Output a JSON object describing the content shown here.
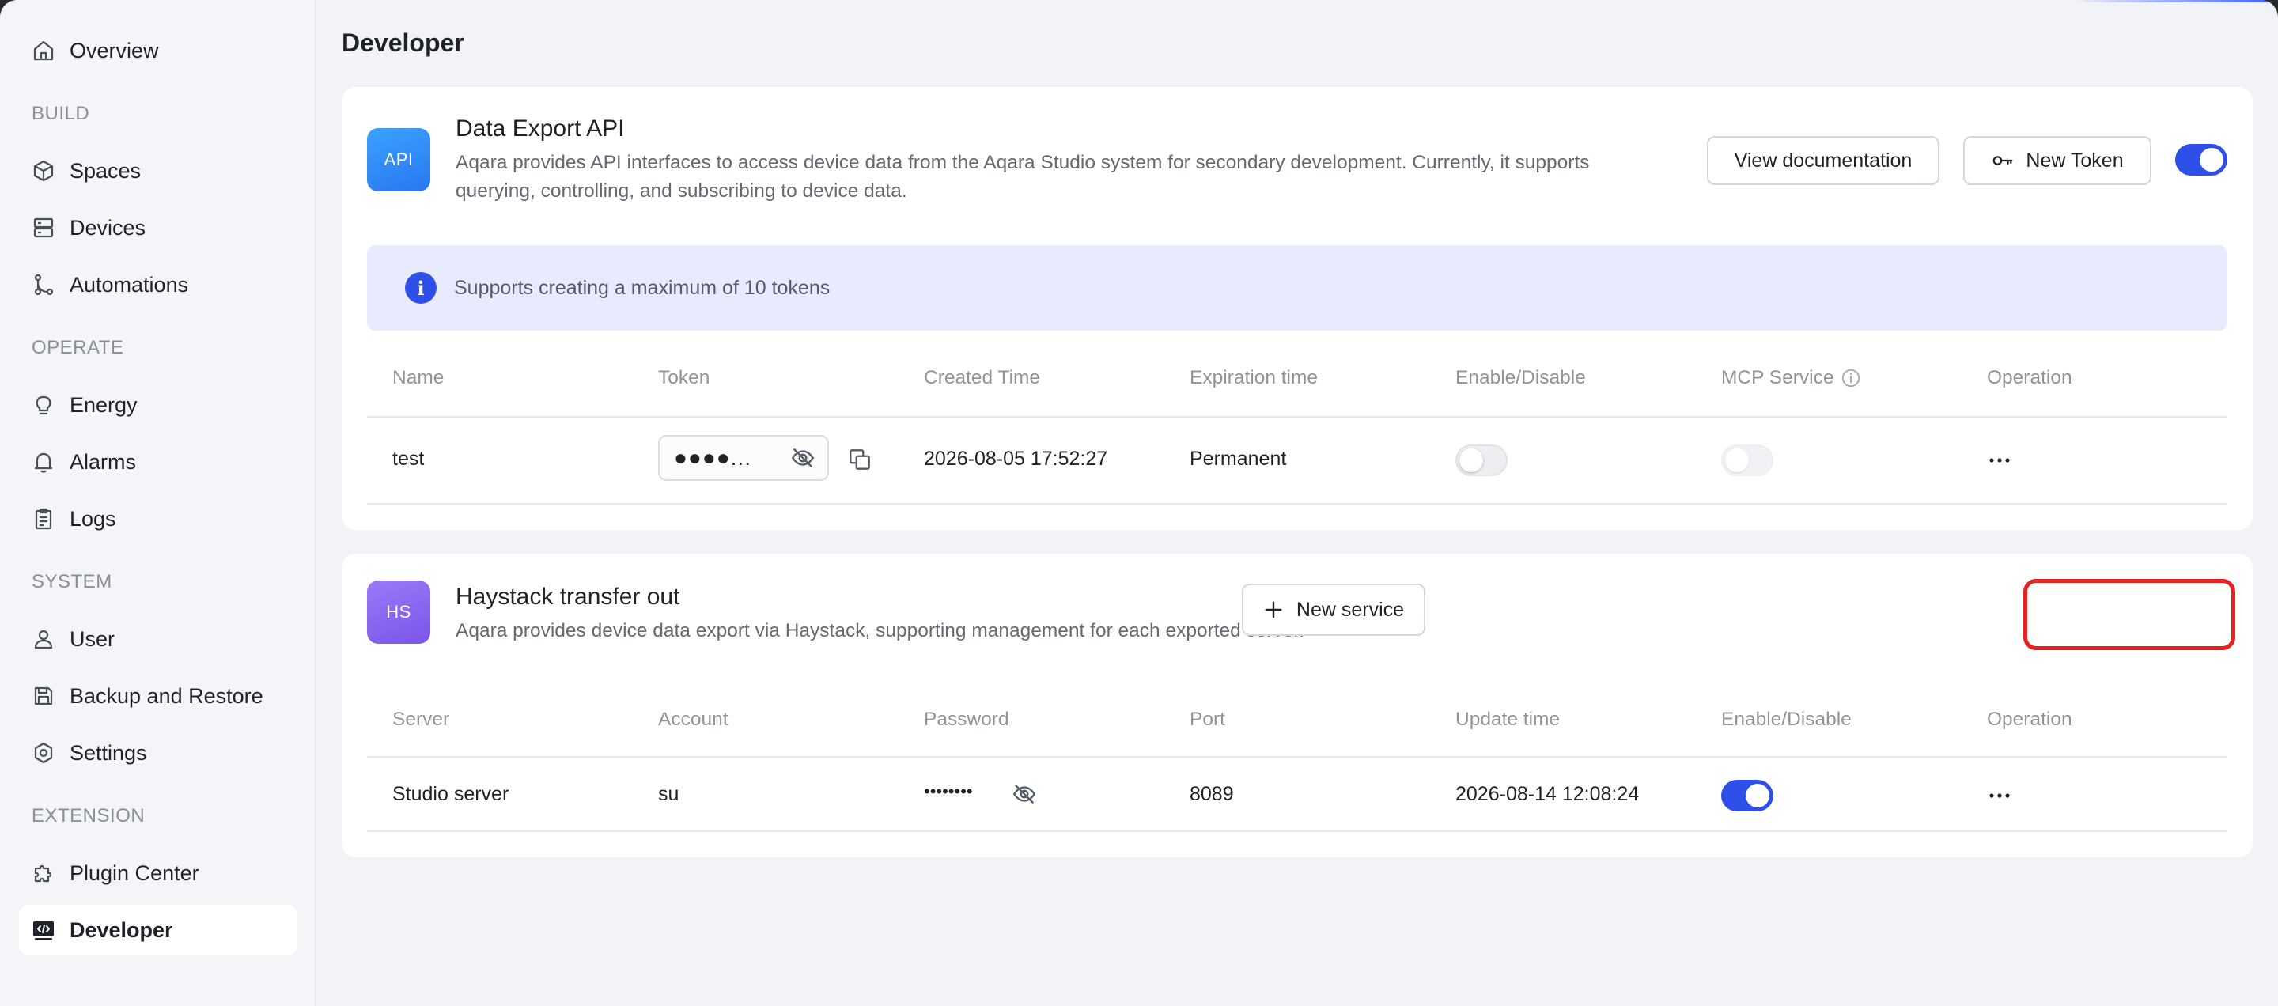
{
  "sidebar": {
    "items": [
      {
        "label": "Overview",
        "icon": "home-icon"
      },
      {
        "section": "BUILD"
      },
      {
        "label": "Spaces",
        "icon": "cube-icon"
      },
      {
        "label": "Devices",
        "icon": "server-icon"
      },
      {
        "label": "Automations",
        "icon": "flow-icon"
      },
      {
        "section": "OPERATE"
      },
      {
        "label": "Energy",
        "icon": "bulb-icon"
      },
      {
        "label": "Alarms",
        "icon": "bell-icon"
      },
      {
        "label": "Logs",
        "icon": "clipboard-icon"
      },
      {
        "section": "SYSTEM"
      },
      {
        "label": "User",
        "icon": "user-icon"
      },
      {
        "label": "Backup and Restore",
        "icon": "save-icon"
      },
      {
        "label": "Settings",
        "icon": "gear-icon"
      },
      {
        "section": "EXTENSION"
      },
      {
        "label": "Plugin Center",
        "icon": "puzzle-icon"
      },
      {
        "label": "Developer",
        "icon": "code-icon",
        "active": true
      }
    ]
  },
  "page": {
    "title": "Developer"
  },
  "api_card": {
    "icon_text": "API",
    "title": "Data Export API",
    "desc_line1": "Aqara provides API interfaces to access device data from the Aqara Studio system for secondary development. Currently, it supports",
    "desc_line2": "querying, controlling, and subscribing to device data.",
    "view_docs_label": "View documentation",
    "new_token_label": "New Token",
    "enabled": true,
    "banner_text": "Supports creating a maximum of 10 tokens",
    "columns": [
      "Name",
      "Token",
      "Created Time",
      "Expiration time",
      "Enable/Disable",
      "MCP Service",
      "Operation"
    ],
    "rows": [
      {
        "name": "test",
        "token_masked": "●●●●...",
        "created": "2026-08-05 17:52:27",
        "expiration": "Permanent",
        "enabled": false,
        "mcp": false
      }
    ]
  },
  "hs_card": {
    "icon_text": "HS",
    "title": "Haystack transfer out",
    "desc": "Aqara provides device data export via Haystack, supporting management for each exported server.",
    "new_service_label": "New service",
    "columns": [
      "Server",
      "Account",
      "Password",
      "Port",
      "Update time",
      "Enable/Disable",
      "Operation"
    ],
    "rows": [
      {
        "server": "Studio server",
        "account": "su",
        "password_masked": "••••••••",
        "port": "8089",
        "update_time": "2026-08-14 12:08:24",
        "enabled": true
      }
    ]
  },
  "colors": {
    "accent": "#2e50e8",
    "api_icon": "#2f8cf6",
    "hs_icon": "#8a63f0",
    "highlight": "#e8201f"
  }
}
